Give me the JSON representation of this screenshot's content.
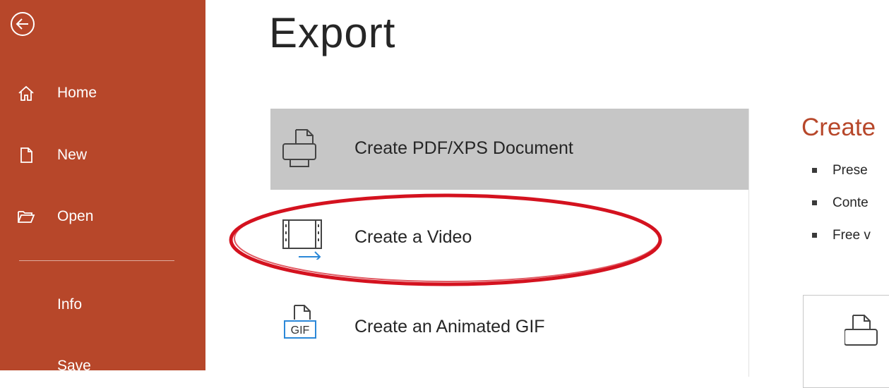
{
  "sidebar": {
    "back_label": "Back",
    "items": [
      {
        "label": "Home",
        "icon": "home-icon"
      },
      {
        "label": "New",
        "icon": "new-document-icon"
      },
      {
        "label": "Open",
        "icon": "open-folder-icon"
      },
      {
        "label": "Info"
      },
      {
        "label": "Save"
      }
    ],
    "color": "#b7472a"
  },
  "main": {
    "title": "Export",
    "options": [
      {
        "label": "Create PDF/XPS Document",
        "icon": "pdf-document-icon",
        "selected": true
      },
      {
        "label": "Create a Video",
        "icon": "video-export-icon",
        "selected": false
      },
      {
        "label": "Create an Animated GIF",
        "icon": "gif-icon",
        "selected": false
      }
    ],
    "gif_badge": "GIF"
  },
  "detail": {
    "title": "Create",
    "bullets": [
      "Prese",
      "Conte",
      "Free v"
    ]
  },
  "annotation": {
    "shape": "ellipse",
    "color": "#d4121f",
    "target": "Create a Video"
  }
}
